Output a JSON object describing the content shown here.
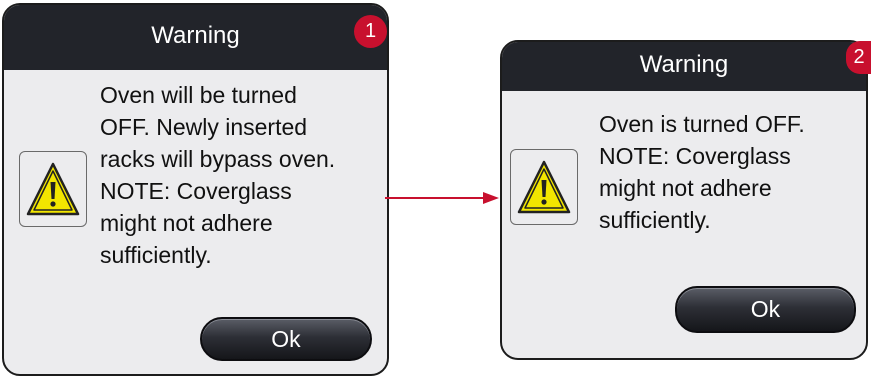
{
  "dialogs": [
    {
      "title": "Warning",
      "message": "Oven will be turned\nOFF. Newly inserted\nracks will bypass oven.\nNOTE: Coverglass\nmight not adhere\nsufficiently.",
      "ok_label": "Ok",
      "icon": "warning-triangle-icon",
      "callout": "1"
    },
    {
      "title": "Warning",
      "message": "Oven is turned OFF.\nNOTE: Coverglass\nmight not adhere\nsufficiently.",
      "ok_label": "Ok",
      "icon": "warning-triangle-icon",
      "callout": "2"
    }
  ],
  "colors": {
    "titlebar": "#22242a",
    "dialog_bg": "#ececee",
    "callout": "#c8102e",
    "arrow": "#c8102e",
    "warning_yellow": "#f2e600"
  }
}
